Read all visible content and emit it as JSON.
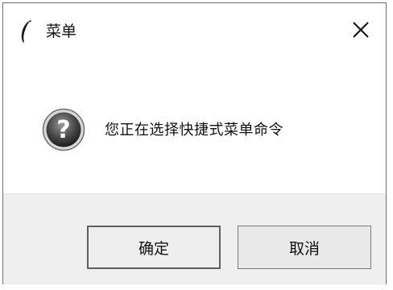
{
  "window": {
    "title": "菜单",
    "icon": "feather-icon",
    "close_icon": "close-icon"
  },
  "dialog": {
    "icon": "question-icon",
    "message": "您正在选择快捷式菜单命令"
  },
  "buttons": {
    "ok_label": "确定",
    "cancel_label": "取消"
  },
  "colors": {
    "window_bg": "#ffffff",
    "footer_bg": "#efefef",
    "button_border": "#7a7a7a",
    "text": "#111111"
  }
}
